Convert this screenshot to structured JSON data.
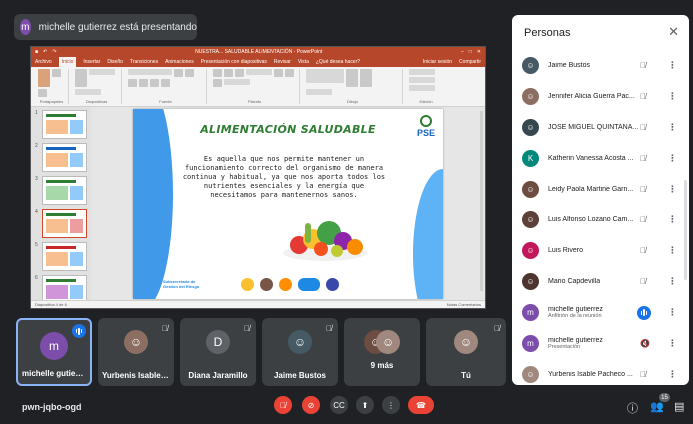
{
  "presenter": {
    "initial": "m",
    "text": "michelle gutierrez está presentando"
  },
  "ppt": {
    "window_title": "NUESTRA... SALUDABLE ALIMENTACIÓN - PowerPoint",
    "tabs": [
      "Archivo",
      "Inicio",
      "Insertar",
      "Diseño",
      "Transiciones",
      "Animaciones",
      "Presentación con diapositivas",
      "Revisar",
      "Vista",
      "¿Qué desea hacer?"
    ],
    "active_tab": "Inicio",
    "ribbon_groups": [
      "Portapapeles",
      "Diapositivas",
      "Fuente",
      "Párrafo",
      "Dibujo",
      "Edición"
    ],
    "signin": "Iniciar sesión",
    "share": "Compartir",
    "thumb_numbers": [
      "1",
      "2",
      "3",
      "4",
      "5",
      "6"
    ],
    "status_left": "Diapositiva 4 de 6",
    "status_right": "Notas  Comentarios",
    "slide": {
      "title": "ALIMENTACIÓN SALUDABLE",
      "body": "Es aquella que nos permite mantener un funcionamiento correcto del organismo de manera continua y habitual, ya que nos aporta todos los nutrientes esenciales y la energía que necesitamos para mantenernos sanos.",
      "logo_right": "PSE",
      "footer_text": "Subsecretaría de Gestión del Riesgo"
    }
  },
  "tiles": [
    {
      "name": "michelle gutierrez",
      "initial": "m",
      "color": "#7c4dab",
      "active": true
    },
    {
      "name": "Yurbenis Isable P...",
      "initial": "",
      "color": "#8d6e63"
    },
    {
      "name": "Diana Jaramillo",
      "initial": "D",
      "color": "#5f6368"
    },
    {
      "name": "Jaime Bustos",
      "initial": "",
      "color": "#455a64"
    },
    {
      "name": "9 más",
      "initial": "",
      "color": "#6d4c41"
    },
    {
      "name": "Tú",
      "initial": "",
      "color": "#a1887f"
    }
  ],
  "bottom": {
    "meeting_code": "pwn-jqbo-ogd",
    "participants_count": "15"
  },
  "panel": {
    "title": "Personas",
    "people": [
      {
        "name": "Jaime Bustos",
        "sub": "",
        "color": "#455a64",
        "initial": ""
      },
      {
        "name": "Jennifer Alicia Guerra Pac...",
        "sub": "",
        "color": "#8d6e63",
        "initial": ""
      },
      {
        "name": "JOSE MIGUEL QUINTANA...",
        "sub": "",
        "color": "#37474f",
        "initial": ""
      },
      {
        "name": "Katherin Vanessa Acosta ...",
        "sub": "",
        "color": "#00897b",
        "initial": "K"
      },
      {
        "name": "Leidy Paola Martine Garn...",
        "sub": "",
        "color": "#6d4c41",
        "initial": ""
      },
      {
        "name": "Luis Alfonso Lozano Cam...",
        "sub": "",
        "color": "#5d4037",
        "initial": ""
      },
      {
        "name": "Luis Rivero",
        "sub": "",
        "color": "#c2185b",
        "initial": ""
      },
      {
        "name": "Mario Capdevilla",
        "sub": "",
        "color": "#4e342e",
        "initial": ""
      },
      {
        "name": "michelle gutierrez",
        "sub": "Anfitrión de la reunión",
        "color": "#7c4dab",
        "initial": "m",
        "speaking": true
      },
      {
        "name": "michelle gutierrez",
        "sub": "Presentación",
        "color": "#7c4dab",
        "initial": "m"
      },
      {
        "name": "Yurbenis Isable Pacheco ...",
        "sub": "",
        "color": "#a1887f",
        "initial": ""
      }
    ]
  },
  "colors": {
    "meet_bg": "#202124",
    "ppt_accent": "#b7472a",
    "end_call": "#ea4335",
    "speaking": "#1a73e8"
  }
}
